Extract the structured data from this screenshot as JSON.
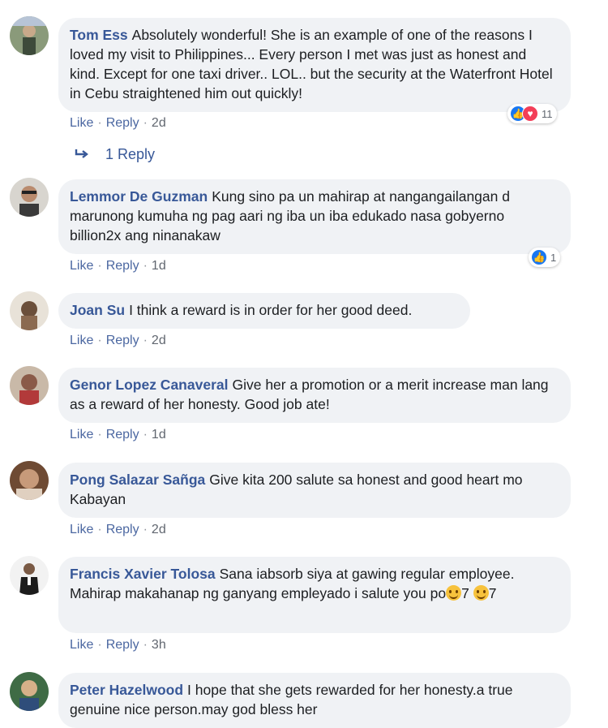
{
  "actions": {
    "like": "Like",
    "reply": "Reply"
  },
  "comments": [
    {
      "author": "Tom Ess",
      "text": "Absolutely wonderful! She is an example of one of the reasons I loved my visit to Philippines... Every person I met was just as honest and kind. Except for one taxi driver.. LOL.. but the security at the Waterfront Hotel in Cebu straightened him out quickly!",
      "time": "2d",
      "reaction_count": "11",
      "reactions": [
        "like-icon",
        "love-icon"
      ],
      "replies": "1 Reply"
    },
    {
      "author": "Lemmor De Guzman",
      "text": "Kung sino pa un mahirap at nangangailangan d marunong kumuha ng pag aari ng iba un iba edukado nasa gobyerno billion2x ang ninanakaw",
      "time": "1d",
      "reaction_count": "1",
      "reactions": [
        "like-icon"
      ]
    },
    {
      "author": "Joan Su",
      "text": "I think a reward is in order for her good deed.",
      "time": "2d"
    },
    {
      "author": "Genor Lopez Canaveral",
      "text": "Give her a promotion or a merit increase man lang as a reward of her honesty. Good job ate!",
      "time": "1d"
    },
    {
      "author": "Pong Salazar Sañga",
      "text": "Give kita 200 salute sa honest and good heart mo Kabayan",
      "time": "2d"
    },
    {
      "author": "Francis Xavier Tolosa",
      "text": "Sana iabsorb siya at gawing regular employee. Mahirap makahanap ng ganyang empleyado i salute you po",
      "text_end_1": "7",
      "text_end_2": "7",
      "time": "3h"
    },
    {
      "author": "Peter Hazelwood",
      "text": "I hope that she gets rewarded for her honesty.a true genuine nice person.may god bless her"
    }
  ]
}
